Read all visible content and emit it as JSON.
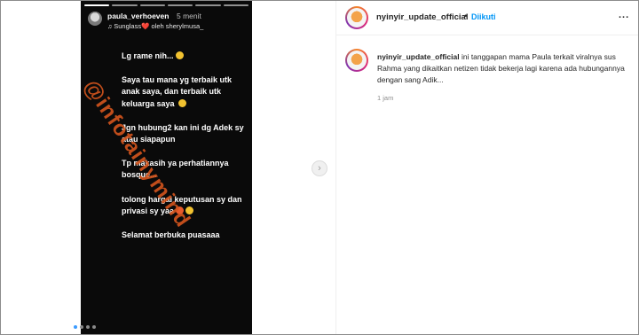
{
  "story": {
    "username": "paula_verhoeven",
    "time": "5 menit",
    "music": "Sunglass❤️ oleh sherylmusa_",
    "lines": [
      "Lg rame nih...",
      "Saya tau mana yg terbaik utk anak saya, dan terbaik utk keluarga saya",
      "Jgn hubung2 kan ini dg Adek sy atau siapapun",
      "Tp makasih ya perhatiannya bosque...",
      "tolong hargai keputusan sy dan privasi sy yaa",
      "Selamat berbuka puasaaa"
    ],
    "watermark": "@infotainymind"
  },
  "post": {
    "account": "nyinyir_update_official",
    "separator": "•",
    "follow_status": "Diikuti",
    "more": "...",
    "caption_user": "nyinyir_update_official",
    "caption_text": " ini tanggapan mama Paula terkait viralnya sus Rahma yang dikaitkan netizen tidak bekerja lagi karena ada hubungannya dengan sang Adik...",
    "time_ago": "1 jam"
  },
  "colors": {
    "follow": "#0095f6",
    "watermark": "#d4551d",
    "story_bg": "#0a0a0a"
  }
}
